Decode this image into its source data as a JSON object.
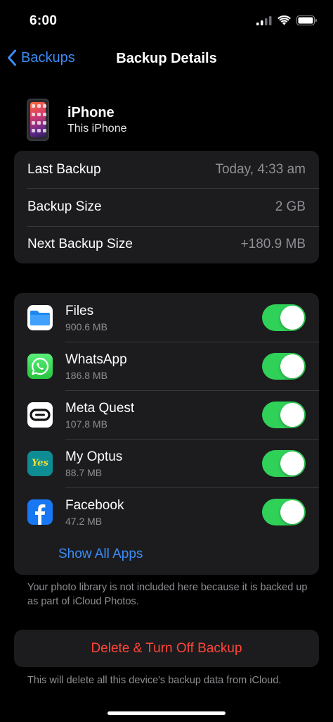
{
  "status_bar": {
    "time": "6:00",
    "icons": [
      "cellular-signal-icon",
      "wifi-icon",
      "battery-icon"
    ]
  },
  "nav": {
    "back_label": "Backups",
    "title": "Backup Details"
  },
  "device": {
    "name": "iPhone",
    "subtitle": "This iPhone"
  },
  "backup_info": [
    {
      "label": "Last Backup",
      "value": "Today, 4:33 am"
    },
    {
      "label": "Backup Size",
      "value": "2 GB"
    },
    {
      "label": "Next Backup Size",
      "value": "+180.9 MB"
    }
  ],
  "apps": [
    {
      "name": "Files",
      "size": "900.6 MB",
      "icon": "files-app-icon",
      "enabled": true
    },
    {
      "name": "WhatsApp",
      "size": "186.8 MB",
      "icon": "whatsapp-app-icon",
      "enabled": true
    },
    {
      "name": "Meta Quest",
      "size": "107.8 MB",
      "icon": "meta-quest-app-icon",
      "enabled": true
    },
    {
      "name": "My Optus",
      "size": "88.7 MB",
      "icon": "my-optus-app-icon",
      "enabled": true
    },
    {
      "name": "Facebook",
      "size": "47.2 MB",
      "icon": "facebook-app-icon",
      "enabled": true
    }
  ],
  "optus_icon_text": "Yes",
  "show_all_label": "Show All Apps",
  "photo_note": "Your photo library is not included here because it is backed up as part of iCloud Photos.",
  "delete_label": "Delete & Turn Off Backup",
  "delete_note": "This will delete all this device's backup data from iCloud.",
  "colors": {
    "accent": "#3b8cf7",
    "toggle_on": "#30d158",
    "destructive": "#ff453a",
    "group_bg": "#1c1c1e"
  }
}
